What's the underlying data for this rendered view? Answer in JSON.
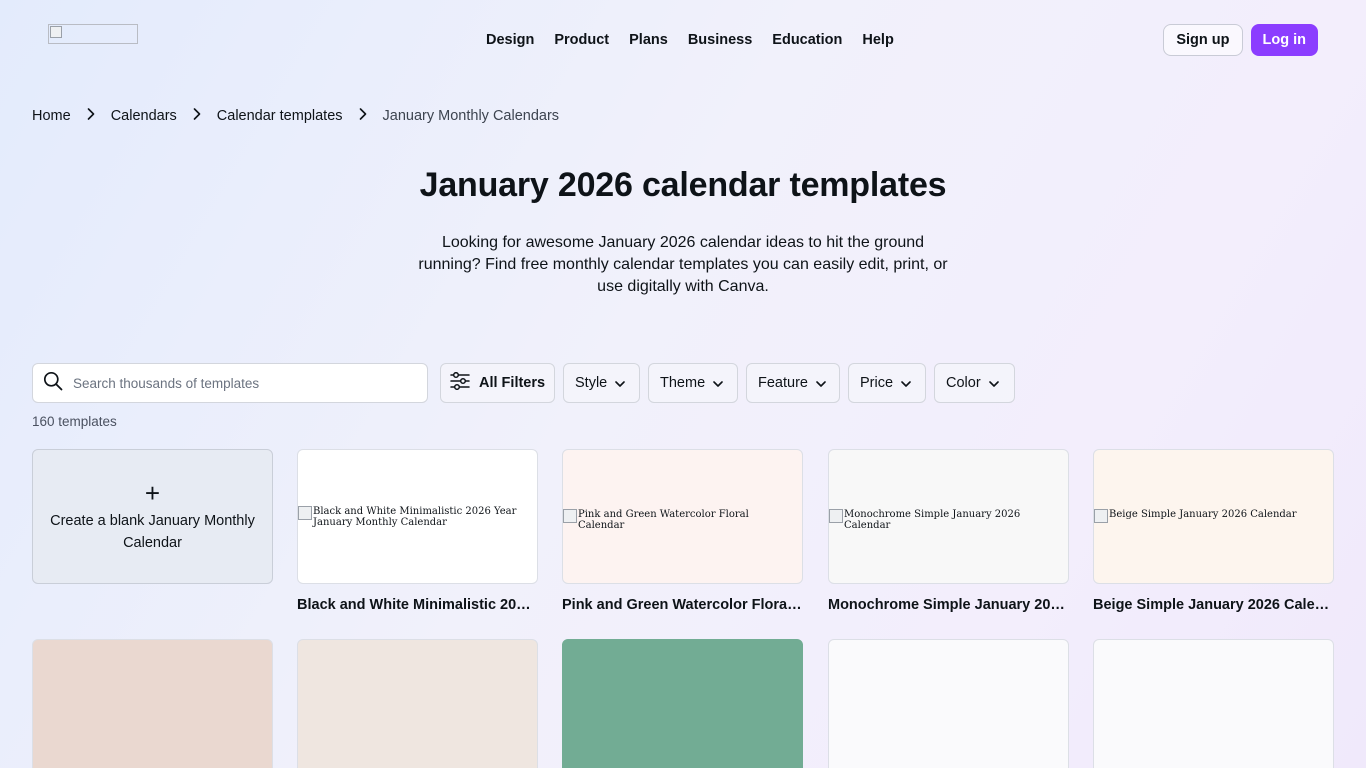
{
  "header": {
    "nav": [
      "Design",
      "Product",
      "Plans",
      "Business",
      "Education",
      "Help"
    ],
    "signup_label": "Sign up",
    "login_label": "Log in",
    "brand_color": "#8b3dff"
  },
  "breadcrumb": {
    "items": [
      "Home",
      "Calendars",
      "Calendar templates"
    ],
    "current": "January Monthly Calendars"
  },
  "page": {
    "title": "January 2026 calendar templates",
    "subtitle": "Looking for awesome January 2026 calendar ideas to hit the ground running? Find free monthly calendar templates you can easily edit, print, or use digitally with Canva."
  },
  "search": {
    "placeholder": "Search thousands of templates",
    "icon": "search-icon"
  },
  "filters": {
    "all_label": "All Filters",
    "style": "Style",
    "theme": "Theme",
    "feature": "Feature",
    "price": "Price",
    "color": "Color"
  },
  "results": {
    "count": "160 templates"
  },
  "blank_card": {
    "plus": "+",
    "label": "Create a blank January Monthly Calendar"
  },
  "templates": [
    {
      "title": "Black and White Minimalistic 2026 Year January Monthly Calendar",
      "alt": "Black and White Minimalistic 2026 Year January Monthly Calendar",
      "bg": "#ffffff"
    },
    {
      "title": "Pink and Green Watercolor Floral Calendar",
      "alt": "Pink and Green Watercolor Floral Calendar",
      "bg": "#fdf3f1"
    },
    {
      "title": "Monochrome Simple January 2026 Calendar",
      "alt": "Monochrome Simple January 2026 Calendar",
      "bg": "#f8f8f8"
    },
    {
      "title": "Beige Simple January 2026 Calendar",
      "alt": "Beige Simple January 2026 Calendar",
      "bg": "#fdf5ee"
    }
  ],
  "row2_colors": [
    "#ead8d0",
    "#efe6e0",
    "#72ac94",
    "#fafafc",
    "#fafafc"
  ]
}
